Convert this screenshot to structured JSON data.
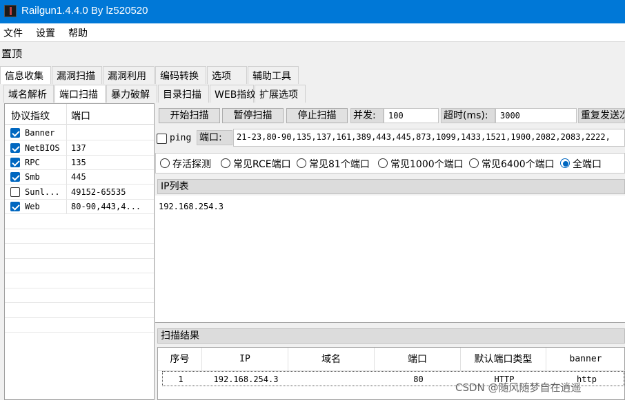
{
  "window": {
    "title": "Railgun1.4.4.0 By lz520520"
  },
  "menu": [
    "文件",
    "设置",
    "帮助"
  ],
  "pin_label": "置顶",
  "tabs_main": [
    "信息收集",
    "漏洞扫描",
    "漏洞利用",
    "编码转换",
    "选项",
    "辅助工具"
  ],
  "tabs_sub": [
    "域名解析",
    "端口扫描",
    "暴力破解",
    "目录扫描",
    "WEB指纹",
    "扩展选项"
  ],
  "protocol_table": {
    "headers": [
      "协议指纹",
      "端口"
    ],
    "rows": [
      {
        "name": "Banner",
        "ports": "",
        "checked": true
      },
      {
        "name": "NetBIOS",
        "ports": "137",
        "checked": true
      },
      {
        "name": "RPC",
        "ports": "135",
        "checked": true
      },
      {
        "name": "Smb",
        "ports": "445",
        "checked": true
      },
      {
        "name": "Sunl...",
        "ports": "49152-65535",
        "checked": false
      },
      {
        "name": "Web",
        "ports": "80-90,443,4...",
        "checked": true
      }
    ]
  },
  "scan_controls": {
    "start": "开始扫描",
    "pause": "暂停扫描",
    "stop": "停止扫描",
    "concurrency_label": "并发:",
    "concurrency_value": "100",
    "timeout_label": "超时(ms):",
    "timeout_value": "3000",
    "resend_label": "重复发送次"
  },
  "ping": {
    "label": "ping",
    "checked": false
  },
  "ports": {
    "label": "端口:",
    "value": "21-23,80-90,135,137,161,389,443,445,873,1099,1433,1521,1900,2082,2083,2222,"
  },
  "port_presets": [
    {
      "label": "存活探测",
      "selected": false
    },
    {
      "label": "常见RCE端口",
      "selected": false
    },
    {
      "label": "常见81个端口",
      "selected": false
    },
    {
      "label": "常见1000个端口",
      "selected": false
    },
    {
      "label": "常见6400个端口",
      "selected": false
    },
    {
      "label": "全端口",
      "selected": true
    }
  ],
  "ip_list": {
    "title": "IP列表",
    "entries": [
      "192.168.254.3"
    ]
  },
  "results": {
    "title": "扫描结果",
    "headers": [
      "序号",
      "IP",
      "域名",
      "端口",
      "默认端口类型",
      "banner"
    ],
    "rows": [
      [
        "1",
        "192.168.254.3",
        "",
        "80",
        "HTTP",
        "http"
      ]
    ]
  },
  "watermark": "CSDN @随风随梦自在逍遥"
}
